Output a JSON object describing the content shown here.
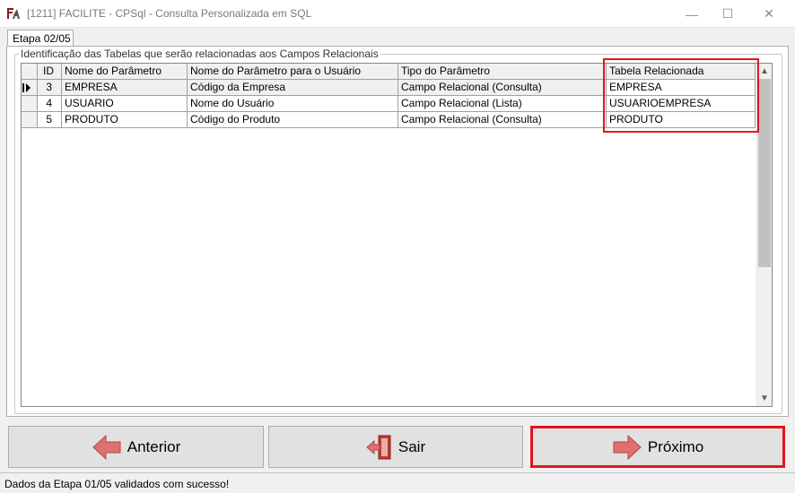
{
  "window": {
    "title": "[1211] FACILITE - CPSql - Consulta Personalizada em SQL",
    "controls": {
      "minimize": "—",
      "maximize": "☐",
      "close": "✕"
    },
    "icon": "app-logo-icon"
  },
  "tab": {
    "label": "Etapa 02/05"
  },
  "group": {
    "label": "Identificação das Tabelas que serão relacionadas aos Campos Relacionais"
  },
  "grid": {
    "columns": [
      "ID",
      "Nome do Parâmetro",
      "Nome do Parâmetro para o Usuário",
      "Tipo do Parâmetro",
      "Tabela Relacionada"
    ],
    "rows": [
      {
        "id": "3",
        "name": "EMPRESA",
        "user_name": "Código da Empresa",
        "type": "Campo Relacional (Consulta)",
        "table": "EMPRESA"
      },
      {
        "id": "4",
        "name": "USUARIO",
        "user_name": "Nome do Usuário",
        "type": "Campo Relacional (Lista)",
        "table": "USUARIOEMPRESA"
      },
      {
        "id": "5",
        "name": "PRODUTO",
        "user_name": "Código do Produto",
        "type": "Campo Relacional (Consulta)",
        "table": "PRODUTO"
      }
    ],
    "selected_row": 0
  },
  "buttons": {
    "previous": "Anterior",
    "exit": "Sair",
    "next": "Próximo"
  },
  "colors": {
    "highlight": "#e0161b",
    "arrow": "#e07070"
  },
  "status": {
    "message": "Dados da Etapa 01/05 validados com sucesso!"
  }
}
